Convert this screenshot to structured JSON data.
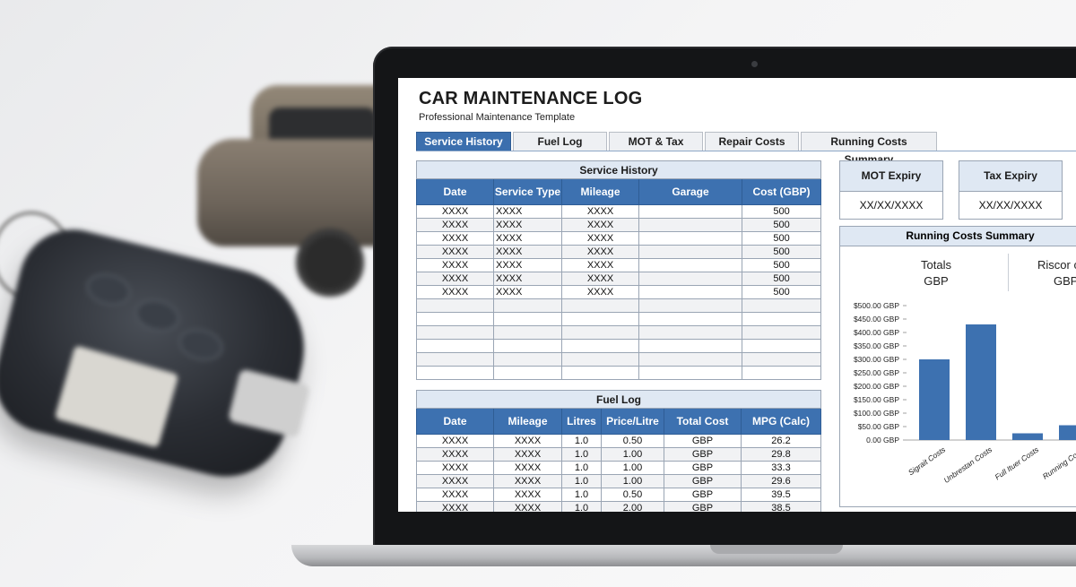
{
  "sheet": {
    "title": "CAR MAINTENANCE LOG",
    "subtitle": "Professional Maintenance Template"
  },
  "tabs": [
    {
      "label": "Service History",
      "active": true
    },
    {
      "label": "Fuel Log",
      "active": false
    },
    {
      "label": "MOT & Tax",
      "active": false
    },
    {
      "label": "Repair Costs",
      "active": false
    },
    {
      "label": "Running Costs Summary",
      "active": false
    }
  ],
  "service_history": {
    "caption": "Service History",
    "headers": [
      "Date",
      "Service Type",
      "Mileage",
      "Garage",
      "Cost (GBP)"
    ],
    "rows": [
      [
        "XXXX",
        "XXXX",
        "XXXX",
        "",
        "500"
      ],
      [
        "XXXX",
        "XXXX",
        "XXXX",
        "",
        "500"
      ],
      [
        "XXXX",
        "XXXX",
        "XXXX",
        "",
        "500"
      ],
      [
        "XXXX",
        "XXXX",
        "XXXX",
        "",
        "500"
      ],
      [
        "XXXX",
        "XXXX",
        "XXXX",
        "",
        "500"
      ],
      [
        "XXXX",
        "XXXX",
        "XXXX",
        "",
        "500"
      ],
      [
        "XXXX",
        "XXXX",
        "XXXX",
        "",
        "500"
      ],
      [
        "",
        "",
        "",
        "",
        ""
      ],
      [
        "",
        "",
        "",
        "",
        ""
      ],
      [
        "",
        "",
        "",
        "",
        ""
      ],
      [
        "",
        "",
        "",
        "",
        ""
      ],
      [
        "",
        "",
        "",
        "",
        ""
      ],
      [
        "",
        "",
        "",
        "",
        ""
      ]
    ]
  },
  "fuel_log": {
    "caption": "Fuel Log",
    "headers": [
      "Date",
      "Mileage",
      "Litres",
      "Price/Litre",
      "Total Cost",
      "MPG (Calc)"
    ],
    "rows": [
      [
        "XXXX",
        "XXXX",
        "1.0",
        "0.50",
        "GBP",
        "26.2"
      ],
      [
        "XXXX",
        "XXXX",
        "1.0",
        "1.00",
        "GBP",
        "29.8"
      ],
      [
        "XXXX",
        "XXXX",
        "1.0",
        "1.00",
        "GBP",
        "33.3"
      ],
      [
        "XXXX",
        "XXXX",
        "1.0",
        "1.00",
        "GBP",
        "29.6"
      ],
      [
        "XXXX",
        "XXXX",
        "1.0",
        "0.50",
        "GBP",
        "39.5"
      ],
      [
        "XXXX",
        "XXXX",
        "1.0",
        "2.00",
        "GBP",
        "38.5"
      ]
    ]
  },
  "mot": {
    "label": "MOT Expiry",
    "value": "XX/XX/XXXX"
  },
  "tax": {
    "label": "Tax Expiry",
    "value": "XX/XX/XXXX"
  },
  "running_summary": {
    "caption": "Running Costs Summary",
    "kpis": [
      {
        "label": "Totals",
        "value": "GBP"
      },
      {
        "label": "Riscor c",
        "value": "GBP"
      }
    ]
  },
  "chart_data": {
    "type": "bar",
    "categories": [
      "Sigrait Costs",
      "Unbrestan Costs",
      "Full Ituer Costs",
      "Running Costs"
    ],
    "values": [
      300,
      430,
      25,
      55
    ],
    "ylim": [
      0,
      500
    ],
    "yticks": [
      "$500.00 GBP",
      "$450.00 GBP",
      "$400.00 GBP",
      "$350.00 GBP",
      "$300.00 GBP",
      "$250.00 GBP",
      "$200.00 GBP",
      "$150.00 GBP",
      "$100.00 GBP",
      "$50.00 GBP",
      "0.00 GBP"
    ],
    "bar_color": "#3d71b0",
    "grid": false
  },
  "colors": {
    "accent": "#3d71b0",
    "header_light": "#dfe8f3"
  }
}
